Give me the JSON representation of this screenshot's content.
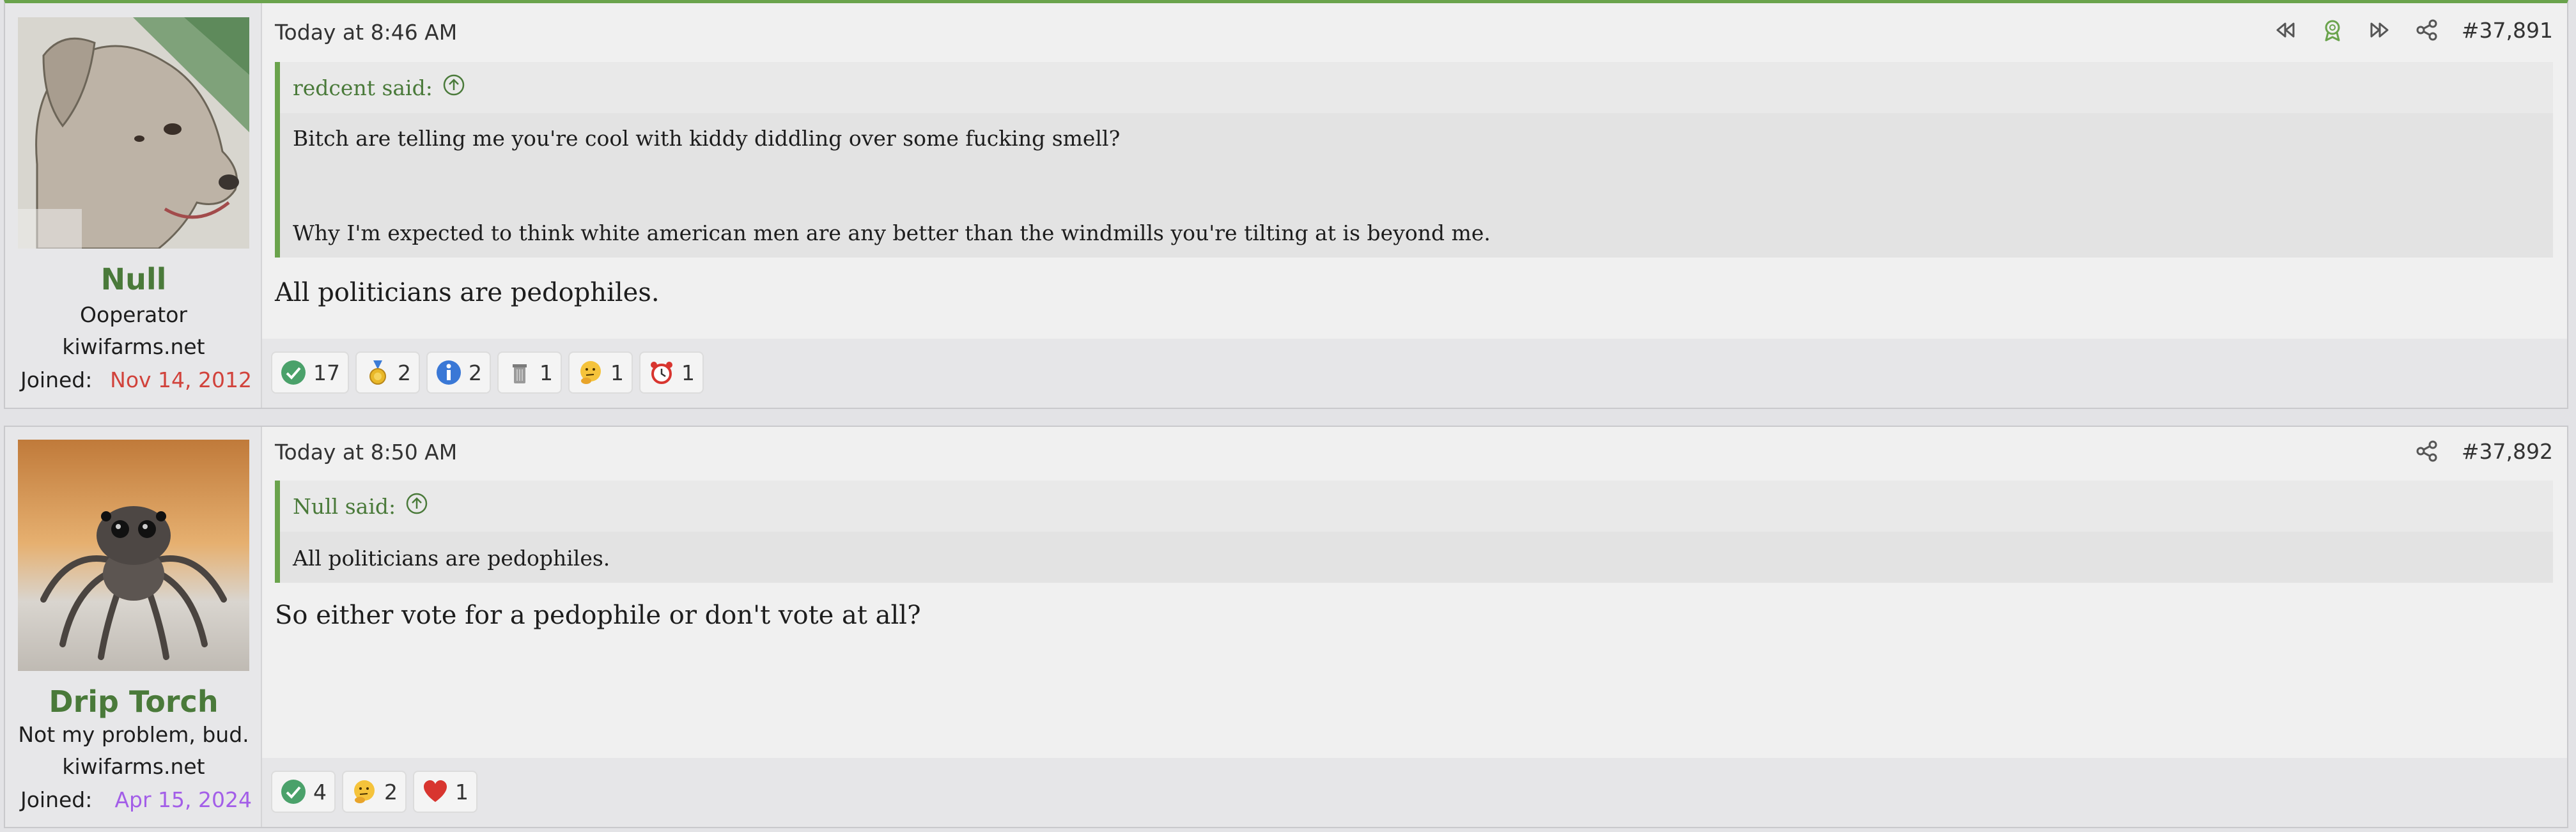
{
  "posts": [
    {
      "user": {
        "name": "Null",
        "title": "Ooperator",
        "domain": "kiwifarms.net",
        "joined_label": "Joined:",
        "joined_date": "Nov 14, 2012",
        "avatar_icon": "dog-avatar"
      },
      "timestamp": "Today at 8:46 AM",
      "post_number": "#37,891",
      "quote": {
        "author": "redcent said:",
        "lines": [
          "Bitch are telling me you're cool with kiddy diddling over some fucking smell?",
          "Why I'm expected to think white american men are any better than the windmills you're tilting at is beyond me."
        ]
      },
      "message": "All politicians are pedophiles.",
      "reactions": [
        {
          "icon": "checkmark-icon",
          "count": "17"
        },
        {
          "icon": "medal-icon",
          "count": "2"
        },
        {
          "icon": "info-icon",
          "count": "2"
        },
        {
          "icon": "trash-can-icon",
          "count": "1"
        },
        {
          "icon": "thinking-face-icon",
          "count": "1"
        },
        {
          "icon": "alarm-clock-icon",
          "count": "1"
        }
      ]
    },
    {
      "user": {
        "name": "Drip Torch",
        "title": "Not my problem, bud.",
        "domain": "kiwifarms.net",
        "joined_label": "Joined:",
        "joined_date": "Apr 15, 2024",
        "avatar_icon": "spider-avatar"
      },
      "timestamp": "Today at 8:50 AM",
      "post_number": "#37,892",
      "quote": {
        "author": "Null said:",
        "lines": [
          "All politicians are pedophiles."
        ]
      },
      "message": "So either vote for a pedophile or don't vote at all?",
      "reactions": [
        {
          "icon": "checkmark-icon",
          "count": "4"
        },
        {
          "icon": "thinking-face-icon",
          "count": "2"
        },
        {
          "icon": "heart-icon",
          "count": "1"
        }
      ]
    }
  ],
  "colors": {
    "accent": "#6aa34c",
    "username": "#4a7a3a",
    "joined_red": "#d1423b",
    "joined_purple": "#a35ee8"
  }
}
